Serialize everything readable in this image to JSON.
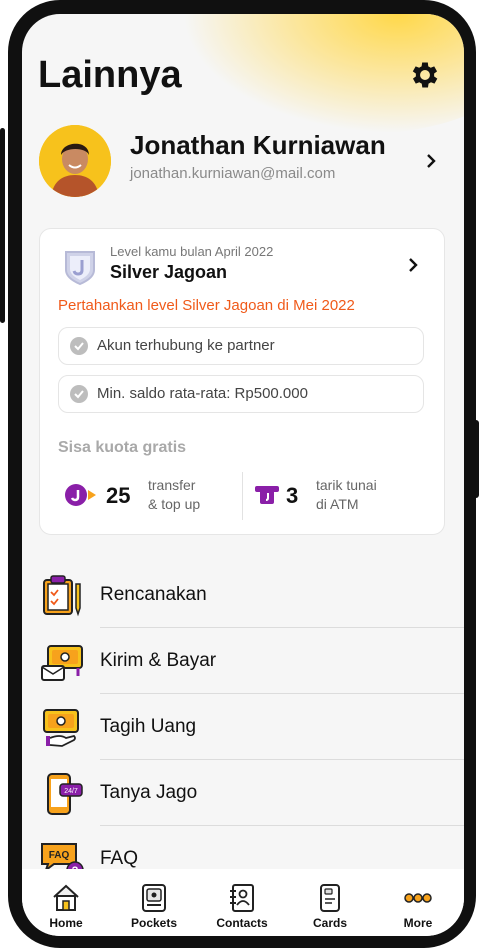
{
  "page": {
    "title": "Lainnya"
  },
  "profile": {
    "name": "Jonathan Kurniawan",
    "email": "jonathan.kurniawan@mail.com"
  },
  "level": {
    "caption": "Level kamu bulan April 2022",
    "name": "Silver Jagoan",
    "maintain_text": "Pertahankan level Silver Jagoan di Mei 2022",
    "requirements": [
      "Akun terhubung ke partner",
      "Min. saldo rata-rata: Rp500.000"
    ]
  },
  "quota": {
    "title": "Sisa kuota gratis",
    "transfer": {
      "count": "25",
      "line1": "transfer",
      "line2": "& top up"
    },
    "atm": {
      "count": "3",
      "line1": "tarik tunai",
      "line2": "di ATM"
    }
  },
  "menu": [
    {
      "label": "Rencanakan",
      "icon": "clipboard-plan-icon"
    },
    {
      "label": "Kirim & Bayar",
      "icon": "send-money-icon"
    },
    {
      "label": "Tagih Uang",
      "icon": "request-money-icon"
    },
    {
      "label": "Tanya Jago",
      "icon": "phone-support-icon"
    },
    {
      "label": "FAQ",
      "icon": "faq-icon"
    }
  ],
  "tabs": [
    {
      "label": "Home",
      "icon": "home-icon"
    },
    {
      "label": "Pockets",
      "icon": "pockets-icon"
    },
    {
      "label": "Contacts",
      "icon": "contacts-icon"
    },
    {
      "label": "Cards",
      "icon": "cards-icon"
    },
    {
      "label": "More",
      "icon": "more-icon"
    }
  ],
  "colors": {
    "accent": "#f7c21c",
    "warning_text": "#f05a1a",
    "purple": "#8a1fa8"
  }
}
